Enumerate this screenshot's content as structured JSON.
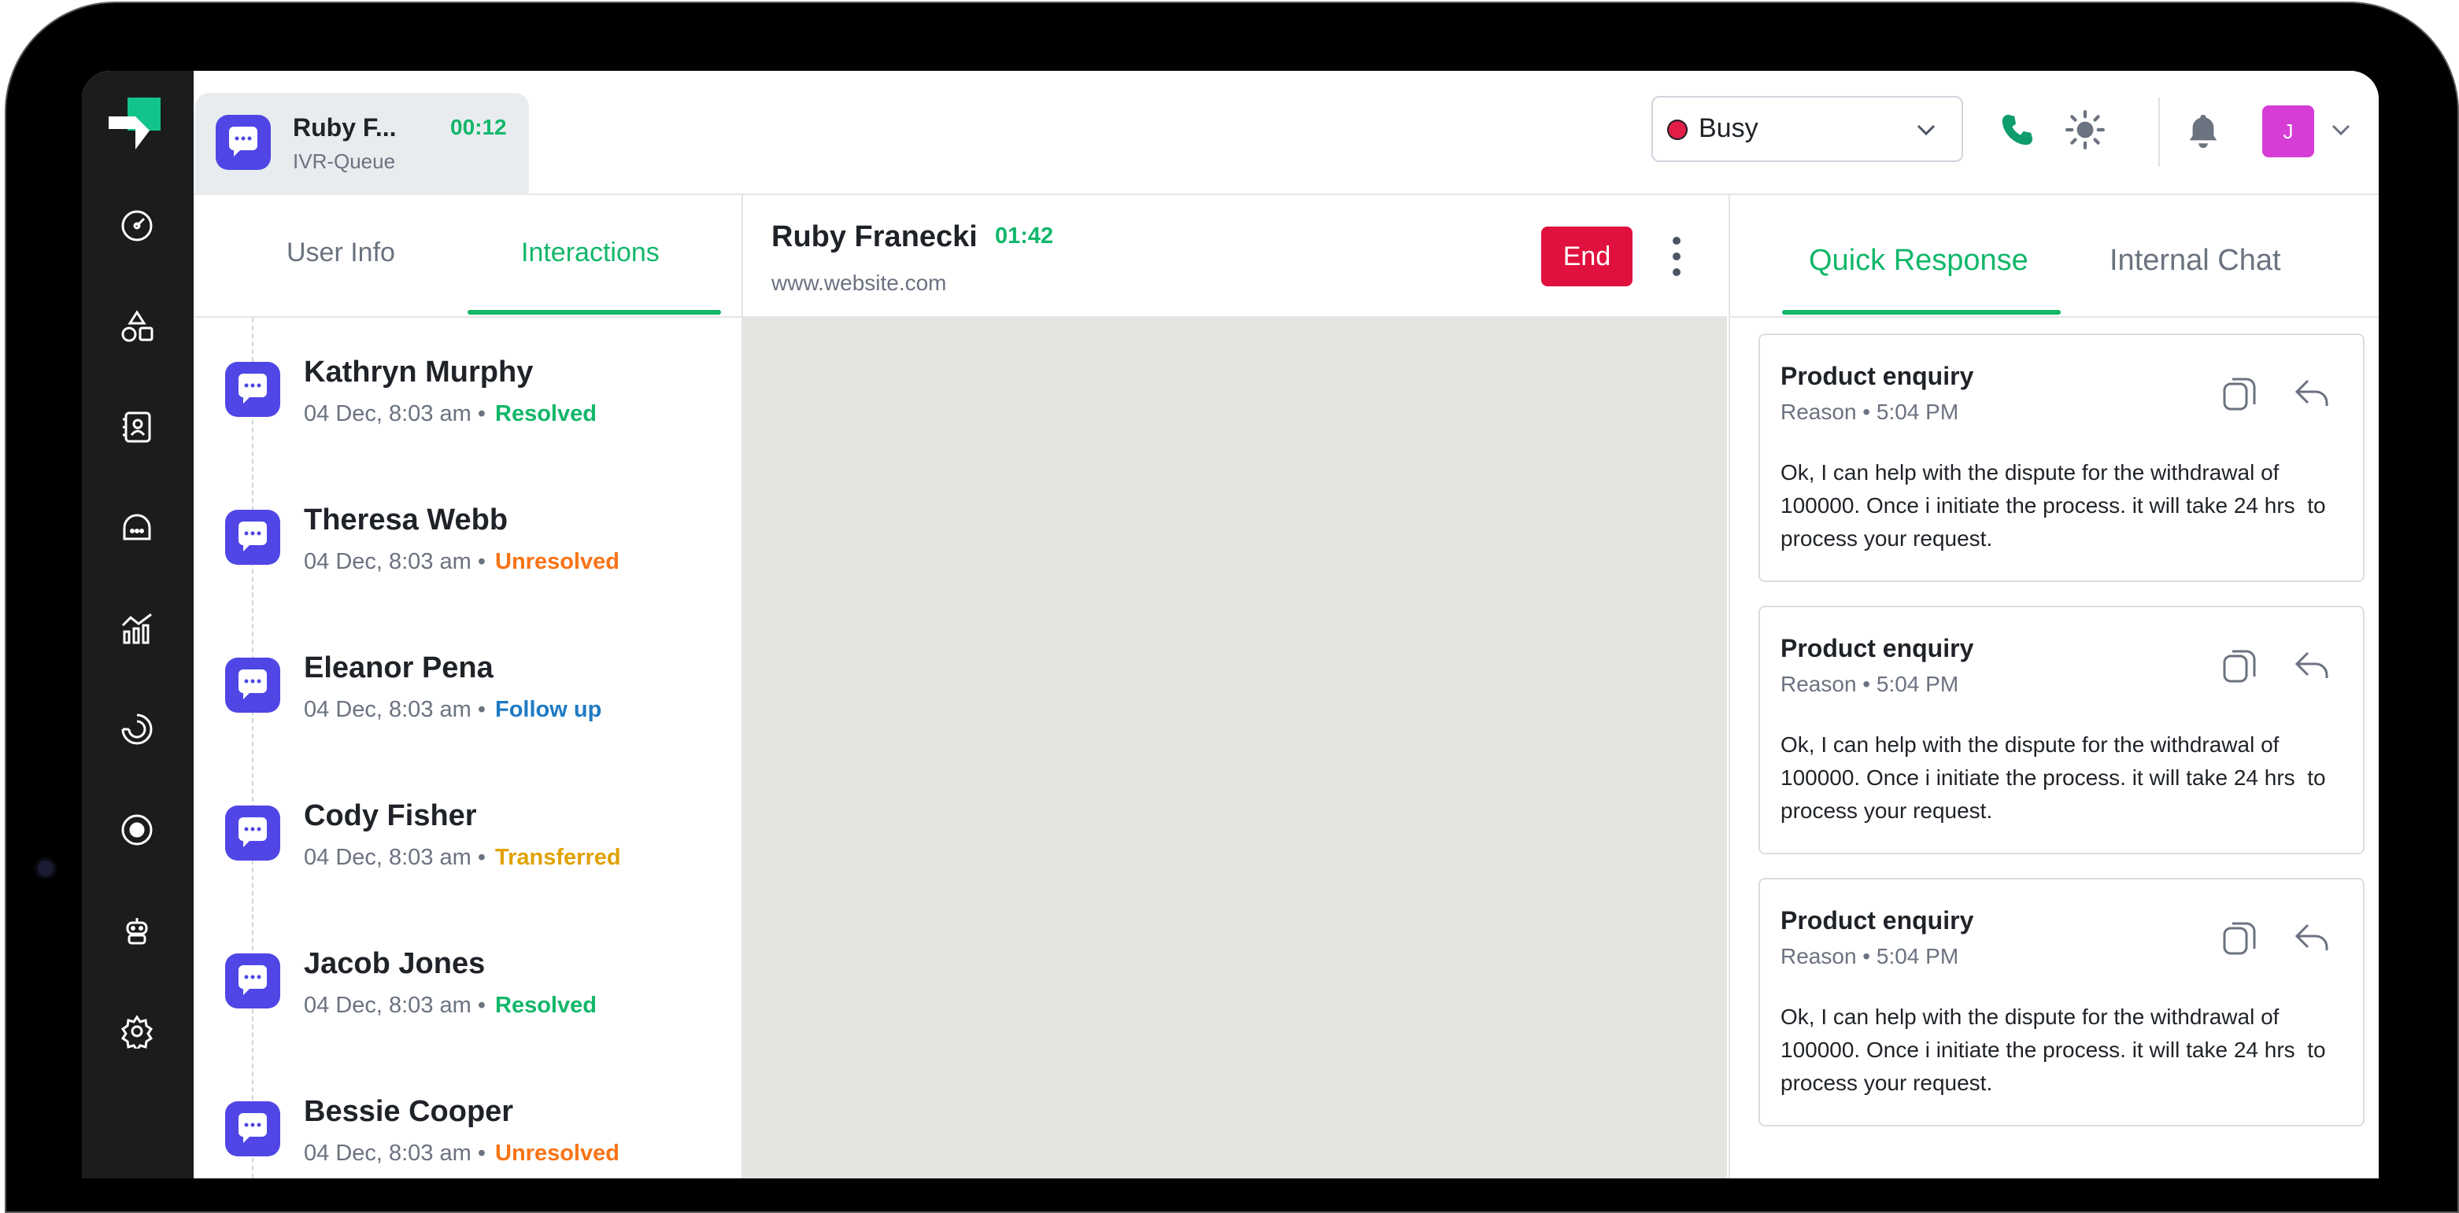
{
  "active_call": {
    "name": "Ruby F...",
    "queue": "IVR-Queue",
    "timer": "00:12"
  },
  "status": {
    "label": "Busy",
    "color": "#e11d48"
  },
  "avatar": {
    "initial": "J",
    "color": "#d63dd6"
  },
  "sidebar": {
    "icons": [
      "dashboard-icon",
      "shapes-icon",
      "contacts-icon",
      "chat-icon",
      "analytics-icon",
      "monitor-icon",
      "record-icon",
      "bot-icon",
      "settings-icon"
    ]
  },
  "left_panel": {
    "tabs": [
      "User Info",
      "Interactions"
    ],
    "active_tab": "Interactions",
    "interactions": [
      {
        "name": "Kathryn Murphy",
        "meta": "04 Dec, 8:03 am •",
        "status": "Resolved",
        "status_color": "#12b76a"
      },
      {
        "name": "Theresa Webb",
        "meta": "04 Dec, 8:03 am •",
        "status": "Unresolved",
        "status_color": "#f97316"
      },
      {
        "name": "Eleanor Pena",
        "meta": "04 Dec, 8:03 am •",
        "status": "Follow up",
        "status_color": "#1f7ac4"
      },
      {
        "name": "Cody Fisher",
        "meta": "04 Dec, 8:03 am •",
        "status": "Transferred",
        "status_color": "#e0a100"
      },
      {
        "name": "Jacob Jones",
        "meta": "04 Dec, 8:03 am •",
        "status": "Resolved",
        "status_color": "#12b76a"
      },
      {
        "name": "Bessie Cooper",
        "meta": "04 Dec, 8:03 am •",
        "status": "Unresolved",
        "status_color": "#f97316"
      }
    ]
  },
  "conversation": {
    "name": "Ruby Franecki",
    "timer": "01:42",
    "url": "www.website.com",
    "end_label": "End"
  },
  "right_panel": {
    "tabs": [
      "Quick Response",
      "Internal Chat"
    ],
    "active_tab": "Quick Response",
    "responses": [
      {
        "title": "Product enquiry",
        "sub": "Reason • 5:04 PM",
        "body": "Ok, I can help with the dispute for the withdrawal of 100000. Once i initiate the process. it will take 24 hrs  to process your request."
      },
      {
        "title": "Product enquiry",
        "sub": "Reason • 5:04 PM",
        "body": "Ok, I can help with the dispute for the withdrawal of 100000. Once i initiate the process. it will take 24 hrs  to process your request."
      },
      {
        "title": "Product enquiry",
        "sub": "Reason • 5:04 PM",
        "body": "Ok, I can help with the dispute for the withdrawal of 100000. Once i initiate the process. it will take 24 hrs  to process your request."
      }
    ]
  },
  "colors": {
    "accent": "#12b76a",
    "brand_chat": "#4f46e5",
    "end_button": "#e0113f"
  }
}
